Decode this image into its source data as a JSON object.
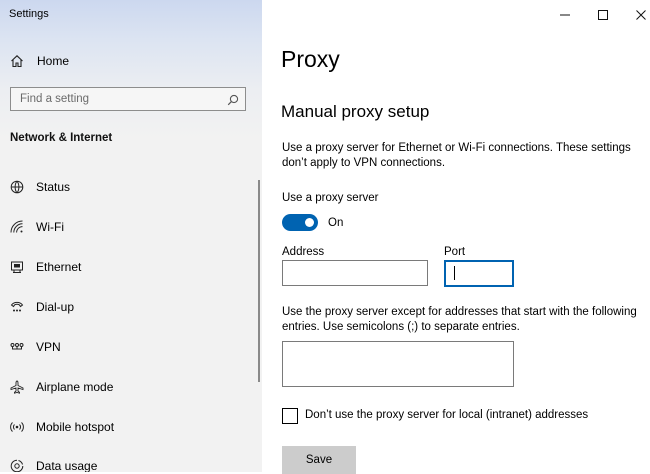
{
  "app": {
    "title": "Settings"
  },
  "sidebar": {
    "home_label": "Home",
    "search_placeholder": "Find a setting",
    "section_title": "Network & Internet",
    "items": [
      {
        "label": "Status",
        "icon": "status-icon"
      },
      {
        "label": "Wi-Fi",
        "icon": "wifi-icon"
      },
      {
        "label": "Ethernet",
        "icon": "ethernet-icon"
      },
      {
        "label": "Dial-up",
        "icon": "dialup-icon"
      },
      {
        "label": "VPN",
        "icon": "vpn-icon"
      },
      {
        "label": "Airplane mode",
        "icon": "airplane-icon"
      },
      {
        "label": "Mobile hotspot",
        "icon": "hotspot-icon"
      },
      {
        "label": "Data usage",
        "icon": "data-usage-icon"
      }
    ]
  },
  "main": {
    "title": "Proxy",
    "section_title": "Manual proxy setup",
    "description": "Use a proxy server for Ethernet or Wi-Fi connections. These settings don’t apply to VPN connections.",
    "use_proxy_label": "Use a proxy server",
    "toggle_state": "On",
    "toggle_on": true,
    "address_label": "Address",
    "address_value": "",
    "port_label": "Port",
    "port_value": "",
    "exceptions_description": "Use the proxy server except for addresses that start with the following entries. Use semicolons (;) to separate entries.",
    "exceptions_value": "",
    "local_checkbox_label": "Don’t use the proxy server for local (intranet) addresses",
    "local_checkbox_checked": false,
    "save_label": "Save"
  },
  "colors": {
    "accent": "#0063b1",
    "sidebar_bg": "#f2f2f2",
    "button_bg": "#cccccc"
  }
}
